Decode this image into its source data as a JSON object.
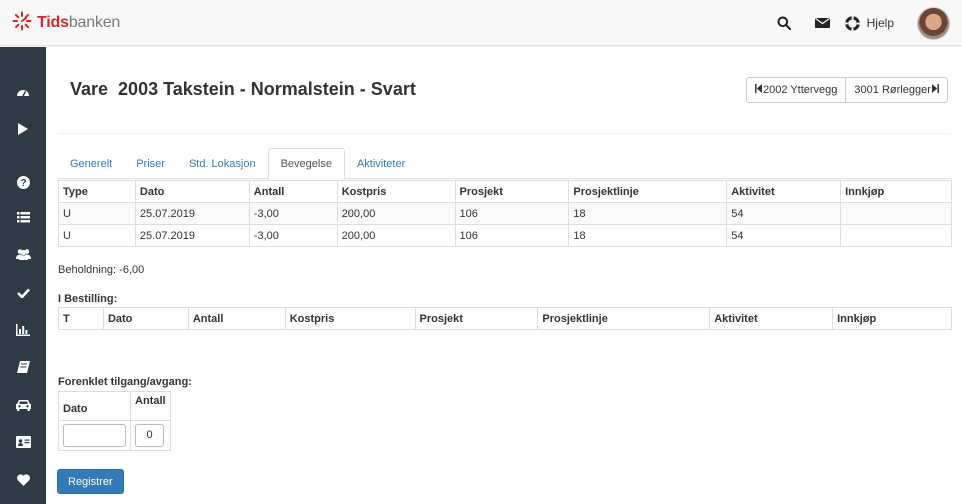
{
  "app": {
    "logo_part1": "Tids",
    "logo_part2": "banken"
  },
  "header": {
    "help_label": "Hjelp",
    "icons": [
      "search-icon",
      "envelope-icon",
      "lifebuoy-icon"
    ]
  },
  "sidebar": {
    "icons": [
      "dashboard-icon",
      "play-icon",
      "question-icon",
      "list-icon",
      "users-icon",
      "check-icon",
      "chart-icon",
      "book-icon",
      "car-icon",
      "id-card-icon",
      "heart-icon"
    ]
  },
  "page": {
    "title": "Vare  2003 Takstein - Normalstein - Svart"
  },
  "nav": {
    "prev_label": "2002 Yttervegg",
    "next_label": "3001 Rørlegger"
  },
  "tabs": [
    {
      "label": "Generelt",
      "active": false
    },
    {
      "label": "Priser",
      "active": false
    },
    {
      "label": "Std. Lokasjon",
      "active": false
    },
    {
      "label": "Bevegelse",
      "active": true
    },
    {
      "label": "Aktiviteter",
      "active": false
    }
  ],
  "movements": {
    "headers": [
      "Type",
      "Dato",
      "Antall",
      "Kostpris",
      "Prosjekt",
      "Prosjektlinje",
      "Aktivitet",
      "Innkjøp"
    ],
    "rows": [
      [
        "U",
        "25.07.2019",
        "-3,00",
        "200,00",
        "106",
        "18",
        "54",
        ""
      ],
      [
        "U",
        "25.07.2019",
        "-3,00",
        "200,00",
        "106",
        "18",
        "54",
        ""
      ]
    ]
  },
  "holding": "Beholdning: -6,00",
  "orders": {
    "title": "I Bestilling:",
    "headers": [
      "T",
      "Dato",
      "Antall",
      "Kostpris",
      "Prosjekt",
      "Prosjektlinje",
      "Aktivitet",
      "Innkjøp"
    ]
  },
  "simple": {
    "title": "Forenklet tilgang/avgang:",
    "date_label": "Dato",
    "qty_label": "Antall",
    "qty_value": "0",
    "date_value": "",
    "submit_label": "Registrer"
  }
}
